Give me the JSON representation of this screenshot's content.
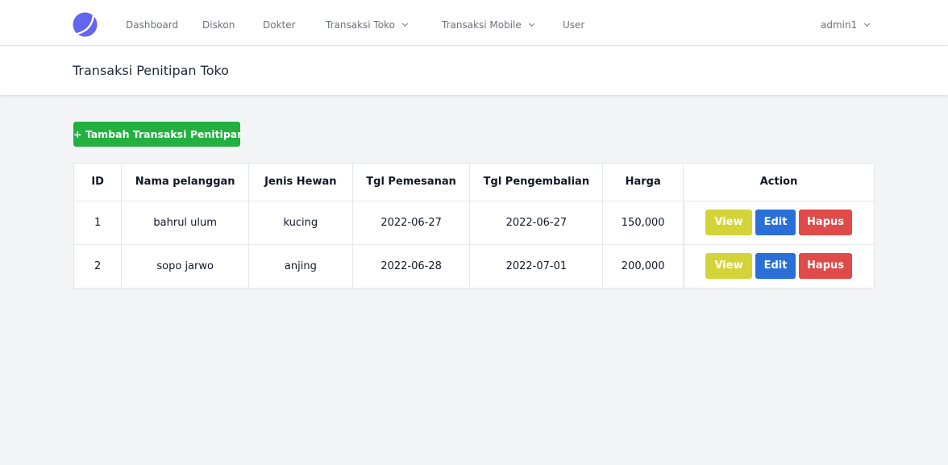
{
  "app": {
    "brand_color": "#6366f1"
  },
  "nav": {
    "items": [
      {
        "label": "Dashboard",
        "has_dropdown": false
      },
      {
        "label": "Diskon",
        "has_dropdown": false
      },
      {
        "label": "Dokter",
        "has_dropdown": false
      },
      {
        "label": "Transaksi Toko",
        "has_dropdown": true
      },
      {
        "label": "Transaksi Mobile",
        "has_dropdown": true
      },
      {
        "label": "User",
        "has_dropdown": false
      }
    ],
    "user_menu": {
      "label": "admin1",
      "has_dropdown": true
    }
  },
  "page": {
    "title": "Transaksi Penitipan Toko",
    "add_button_label": "+ Tambah Transaksi Penitipan"
  },
  "table": {
    "columns": [
      "ID",
      "Nama pelanggan",
      "Jenis Hewan",
      "Tgl Pemesanan",
      "Tgl Pengembalian",
      "Harga",
      "Action"
    ],
    "rows": [
      {
        "id": "1",
        "nama": "bahrul ulum",
        "jenis": "kucing",
        "tgl_pemesanan": "2022-06-27",
        "tgl_pengembalian": "2022-06-27",
        "harga": "150,000"
      },
      {
        "id": "2",
        "nama": "sopo jarwo",
        "jenis": "anjing",
        "tgl_pemesanan": "2022-06-28",
        "tgl_pengembalian": "2022-07-01",
        "harga": "200,000"
      }
    ],
    "actions": {
      "view": "View",
      "edit": "Edit",
      "delete": "Hapus"
    },
    "action_colors": {
      "view": "#d4d43a",
      "edit": "#2a6fd8",
      "delete": "#e04a48"
    }
  }
}
